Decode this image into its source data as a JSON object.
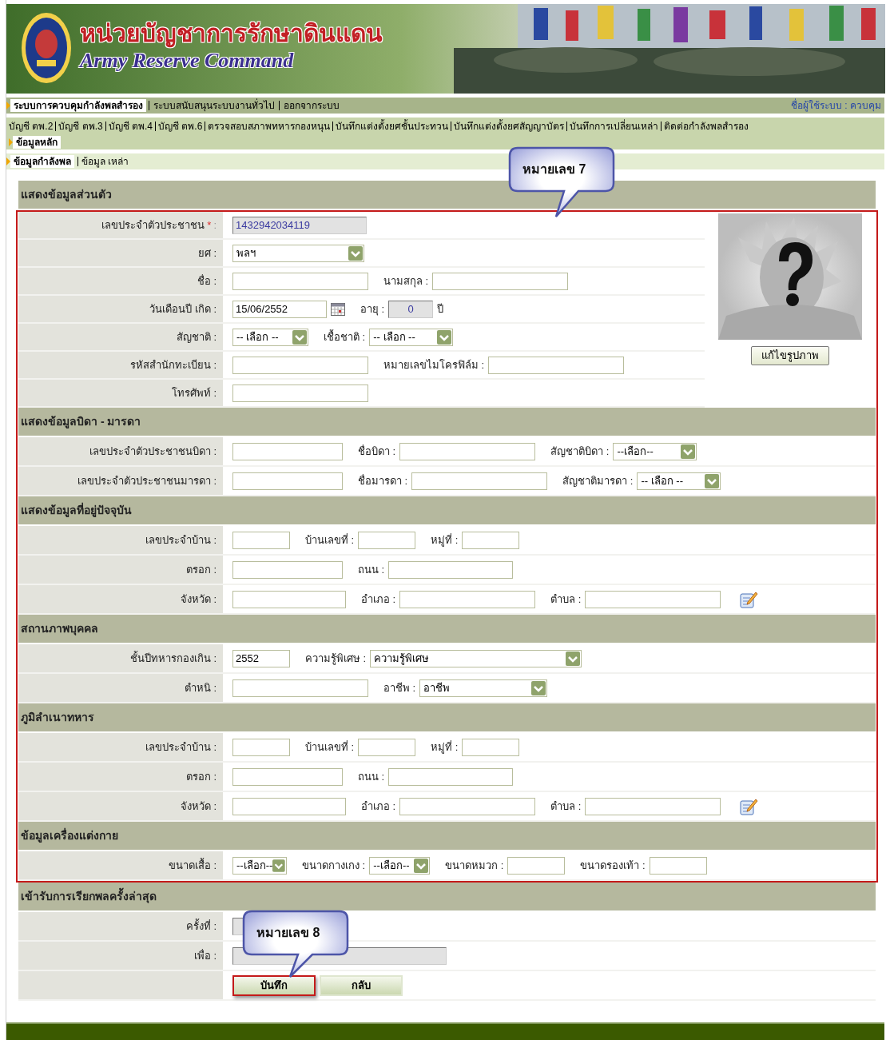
{
  "header": {
    "title": "หน่วยบัญชาการรักษาดินแดน",
    "subtitle": "Army Reserve Command"
  },
  "main_menu": {
    "items": [
      {
        "label": "ระบบการควบคุมกำลังพลสำรอง",
        "selected": true
      },
      {
        "label": "ระบบสนับสนุนระบบงานทั่วไป",
        "selected": false
      },
      {
        "label": "ออกจากระบบ",
        "selected": false
      }
    ],
    "user": "ชื่อผู้ใช้ระบบ : ควบคุม"
  },
  "sub_menu": {
    "items": [
      {
        "label": "บัญชี ตพ.2",
        "selected": false
      },
      {
        "label": "บัญชี ตพ.3",
        "selected": false
      },
      {
        "label": "บัญชี ตพ.4",
        "selected": false
      },
      {
        "label": "บัญชี ตพ.6",
        "selected": false
      },
      {
        "label": "ตรวจสอบสภาพทหารกองหนุน",
        "selected": false
      },
      {
        "label": "บันทึกแต่งตั้งยศชั้นประทวน",
        "selected": false
      },
      {
        "label": "บันทึกแต่งตั้งยศสัญญาบัตร",
        "selected": false
      },
      {
        "label": "บันทึกการเปลี่ยนเหล่า",
        "selected": false
      },
      {
        "label": "ติดต่อกำลังพลสำรอง",
        "selected": false
      },
      {
        "label": "ข้อมูลหลัก",
        "selected": true
      }
    ]
  },
  "tabs": [
    {
      "label": "ข้อมูลกำลังพล",
      "selected": true
    },
    {
      "label": "ข้อมูล เหล่า",
      "selected": false
    }
  ],
  "sections": [
    {
      "title": "แสดงข้อมูลส่วนตัว",
      "highlighted": true,
      "photo": {
        "button": "แก้ไขรูปภาพ"
      },
      "rows": [
        {
          "label": "เลขประจำตัวประชาชน",
          "required_mark": "*",
          "colon": ":",
          "items": [
            {
              "kind": "display",
              "value": "1432942034119"
            }
          ]
        },
        {
          "label": "ยศ :",
          "items": [
            {
              "kind": "select",
              "value": "พลฯ"
            }
          ]
        },
        {
          "label": "ชื่อ :",
          "items": [
            {
              "kind": "input"
            },
            {
              "kind": "label",
              "text": "นามสกุล :"
            },
            {
              "kind": "input"
            }
          ]
        },
        {
          "label": "วันเดือนปี เกิด :",
          "items": [
            {
              "kind": "input",
              "value": "15/06/2552"
            },
            {
              "kind": "calendar"
            },
            {
              "kind": "label",
              "text": "อายุ :"
            },
            {
              "kind": "display",
              "value": "0"
            },
            {
              "kind": "unit",
              "text": "ปี"
            }
          ]
        },
        {
          "label": "สัญชาติ :",
          "items": [
            {
              "kind": "select",
              "value": "-- เลือก --"
            },
            {
              "kind": "label",
              "text": "เชื้อชาติ :"
            },
            {
              "kind": "select",
              "value": "-- เลือก --"
            }
          ]
        },
        {
          "label": "รหัสสำนักทะเบียน :",
          "items": [
            {
              "kind": "input"
            },
            {
              "kind": "label",
              "text": "หมายเลขไมโครฟิล์ม :"
            },
            {
              "kind": "input"
            }
          ]
        },
        {
          "label": "โทรศัพท์ :",
          "items": [
            {
              "kind": "input"
            }
          ]
        }
      ]
    },
    {
      "title": "แสดงข้อมูลบิดา - มารดา",
      "highlighted": true,
      "rows": [
        {
          "label": "เลขประจำตัวประชาชนบิดา :",
          "items": [
            {
              "kind": "input"
            },
            {
              "kind": "label",
              "text": "ชื่อบิดา :"
            },
            {
              "kind": "input"
            },
            {
              "kind": "label",
              "text": "สัญชาติบิดา :"
            },
            {
              "kind": "select",
              "value": "--เลือก--"
            }
          ]
        },
        {
          "label": "เลขประจำตัวประชาชนมารดา :",
          "items": [
            {
              "kind": "input"
            },
            {
              "kind": "label",
              "text": "ชื่อมารดา :"
            },
            {
              "kind": "input"
            },
            {
              "kind": "label",
              "text": "สัญชาติมารดา :"
            },
            {
              "kind": "select",
              "value": "-- เลือก --"
            }
          ]
        }
      ]
    },
    {
      "title": "แสดงข้อมูลที่อยู่ปัจจุบัน",
      "highlighted": true,
      "rows": [
        {
          "label": "เลขประจำบ้าน :",
          "items": [
            {
              "kind": "input"
            },
            {
              "kind": "label",
              "text": "บ้านเลขที่ :"
            },
            {
              "kind": "input"
            },
            {
              "kind": "label",
              "text": "หมู่ที่ :"
            },
            {
              "kind": "input"
            }
          ]
        },
        {
          "label": "ตรอก :",
          "items": [
            {
              "kind": "input"
            },
            {
              "kind": "label",
              "text": "ถนน :"
            },
            {
              "kind": "input"
            }
          ]
        },
        {
          "label": "จังหวัด :",
          "items": [
            {
              "kind": "input"
            },
            {
              "kind": "label",
              "text": "อำเภอ :"
            },
            {
              "kind": "input"
            },
            {
              "kind": "label",
              "text": "ตำบล :"
            },
            {
              "kind": "input"
            },
            {
              "kind": "edit"
            }
          ]
        }
      ]
    },
    {
      "title": "สถานภาพบุคคล",
      "highlighted": true,
      "rows": [
        {
          "label": "ชั้นปีทหารกองเกิน :",
          "items": [
            {
              "kind": "input",
              "value": "2552"
            },
            {
              "kind": "label",
              "text": "ความรู้พิเศษ :"
            },
            {
              "kind": "select",
              "value": "ความรู้พิเศษ"
            }
          ]
        },
        {
          "label": "ตำหนิ :",
          "items": [
            {
              "kind": "input"
            },
            {
              "kind": "label",
              "text": "อาชีพ :"
            },
            {
              "kind": "select",
              "value": "อาชีพ"
            }
          ]
        }
      ]
    },
    {
      "title": "ภูมิลำเนาทหาร",
      "highlighted": true,
      "rows": [
        {
          "label": "เลขประจำบ้าน :",
          "items": [
            {
              "kind": "input"
            },
            {
              "kind": "label",
              "text": "บ้านเลขที่ :"
            },
            {
              "kind": "input"
            },
            {
              "kind": "label",
              "text": "หมู่ที่ :"
            },
            {
              "kind": "input"
            }
          ]
        },
        {
          "label": "ตรอก :",
          "items": [
            {
              "kind": "input"
            },
            {
              "kind": "label",
              "text": "ถนน :"
            },
            {
              "kind": "input"
            }
          ]
        },
        {
          "label": "จังหวัด :",
          "items": [
            {
              "kind": "input"
            },
            {
              "kind": "label",
              "text": "อำเภอ :"
            },
            {
              "kind": "input"
            },
            {
              "kind": "label",
              "text": "ตำบล :"
            },
            {
              "kind": "input"
            },
            {
              "kind": "edit"
            }
          ]
        }
      ]
    },
    {
      "title": "ข้อมูลเครื่องแต่งกาย",
      "highlighted": true,
      "rows": [
        {
          "label": "ขนาดเสื้อ :",
          "items": [
            {
              "kind": "select",
              "value": "--เลือก--"
            },
            {
              "kind": "label",
              "text": "ขนาดกางเกง :"
            },
            {
              "kind": "select",
              "value": "--เลือก--"
            },
            {
              "kind": "label",
              "text": "ขนาดหมวก :"
            },
            {
              "kind": "input"
            },
            {
              "kind": "label",
              "text": "ขนาดรองเท้า :"
            },
            {
              "kind": "input"
            }
          ]
        }
      ]
    },
    {
      "title": "เข้ารับการเรียกพลครั้งล่าสุด",
      "highlighted": false,
      "rows": [
        {
          "label": "ครั้งที่ :",
          "items": [
            {
              "kind": "display"
            }
          ]
        },
        {
          "label": "เพื่อ :",
          "items": [
            {
              "kind": "display"
            }
          ]
        },
        {
          "items": [
            {
              "kind": "button",
              "text": "บันทึก",
              "highlighted": true
            },
            {
              "kind": "button",
              "text": "กลับ",
              "highlighted": false
            }
          ]
        }
      ]
    }
  ],
  "callouts": [
    {
      "text": "หมายเลข 7"
    },
    {
      "text": "หมายเลข 8"
    }
  ]
}
